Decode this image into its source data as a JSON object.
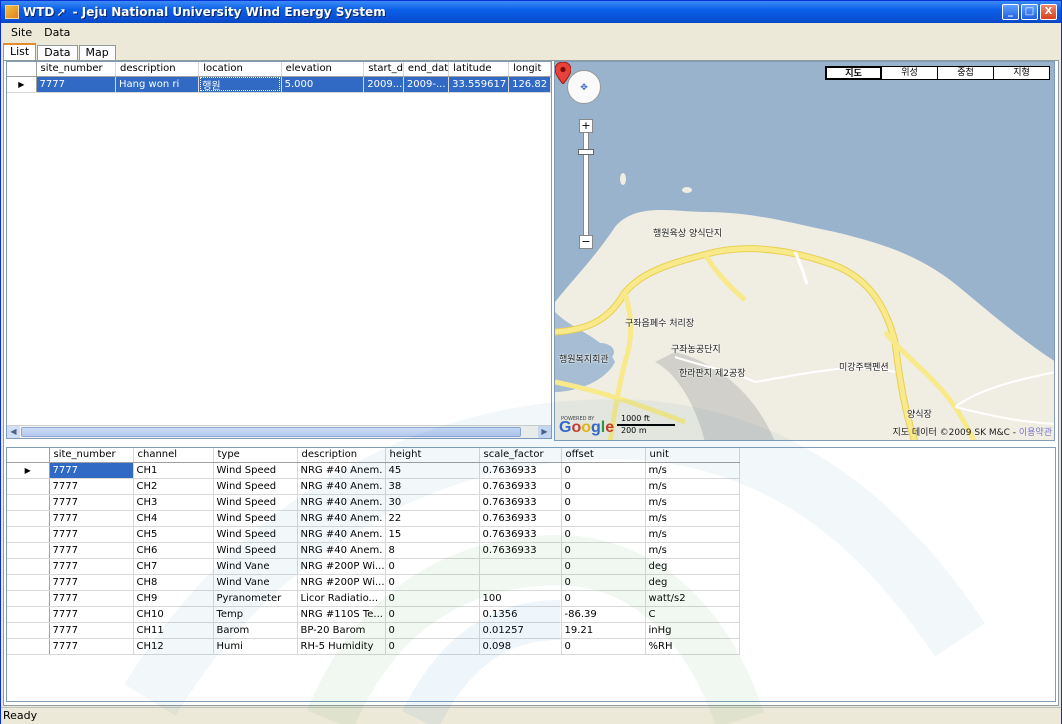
{
  "window": {
    "title_prefix": "WTD",
    "title_suffix": " - Jeju National University Wind Energy System",
    "buttons": {
      "minimize": "_",
      "maximize": "□",
      "close": "X"
    }
  },
  "menu": {
    "site": "Site",
    "data": "Data"
  },
  "tabs": [
    "List",
    "Data",
    "Map"
  ],
  "site_grid": {
    "columns": [
      "site_number",
      "description",
      "location",
      "elevation",
      "start_d",
      "end_dat",
      "latitude",
      "longit"
    ],
    "rows": [
      [
        "7777",
        "Hang won ri",
        "행원",
        "5.000",
        "2009...",
        "2009-...",
        "33.559617",
        "126.82"
      ]
    ]
  },
  "map": {
    "types": [
      "지도",
      "위성",
      "중첩",
      "지형"
    ],
    "labels": [
      "행원육상 양식단지",
      "구좌읍폐수 처리장",
      "구좌농공단지",
      "행원복지회관",
      "한라판지 제2공장",
      "미강주택펜션",
      "양식장"
    ],
    "scale_ft": "1000 ft",
    "scale_m": "200 m",
    "powered_by": "POWERED BY",
    "google": "Google",
    "copyright": "지도 데이터 ©2009 SK M&C - ",
    "terms_link": "이용약관"
  },
  "channel_grid": {
    "columns": [
      "site_number",
      "channel",
      "type",
      "description",
      "height",
      "scale_factor",
      "offset",
      "unit"
    ],
    "rows": [
      [
        "7777",
        "CH1",
        "Wind Speed",
        "NRG #40 Anem.",
        "45",
        "0.7636933",
        "0",
        "m/s"
      ],
      [
        "7777",
        "CH2",
        "Wind Speed",
        "NRG #40 Anem.",
        "38",
        "0.7636933",
        "0",
        "m/s"
      ],
      [
        "7777",
        "CH3",
        "Wind  Speed",
        "NRG #40 Anem.",
        "30",
        "0.7636933",
        "0",
        "m/s"
      ],
      [
        "7777",
        "CH4",
        "Wind Speed",
        "NRG #40 Anem.",
        "22",
        "0.7636933",
        "0",
        "m/s"
      ],
      [
        "7777",
        "CH5",
        "Wind Speed",
        "NRG #40 Anem.",
        "15",
        "0.7636933",
        "0",
        "m/s"
      ],
      [
        "7777",
        "CH6",
        "Wind Speed",
        "NRG #40 Anem.",
        "8",
        "0.7636933",
        "0",
        "m/s"
      ],
      [
        "7777",
        "CH7",
        "Wind Vane",
        "NRG #200P Wi...",
        "0",
        "",
        "0",
        "deg"
      ],
      [
        "7777",
        "CH8",
        "Wind Vane",
        "NRG #200P Wi...",
        "0",
        "",
        "0",
        "deg"
      ],
      [
        "7777",
        "CH9",
        "Pyranometer",
        "Licor Radiatio...",
        "0",
        "100",
        "0",
        "watt/s2"
      ],
      [
        "7777",
        "CH10",
        "Temp",
        "NRG #110S Te...",
        "0",
        "0.1356",
        "-86.39",
        "C"
      ],
      [
        "7777",
        "CH11",
        "Barom",
        "BP-20 Barom",
        "0",
        "0.01257",
        "19.21",
        "inHg"
      ],
      [
        "7777",
        "CH12",
        "Humi",
        "RH-5 Humidity",
        "0",
        "0.098",
        "0",
        "%RH"
      ]
    ]
  },
  "status": "Ready",
  "colors": {
    "selection": "#316ac5",
    "titlebar": "#0a5fe8",
    "map_sea": "#99b3cc",
    "map_land": "#f0ede3",
    "road": "#f6e27a"
  }
}
